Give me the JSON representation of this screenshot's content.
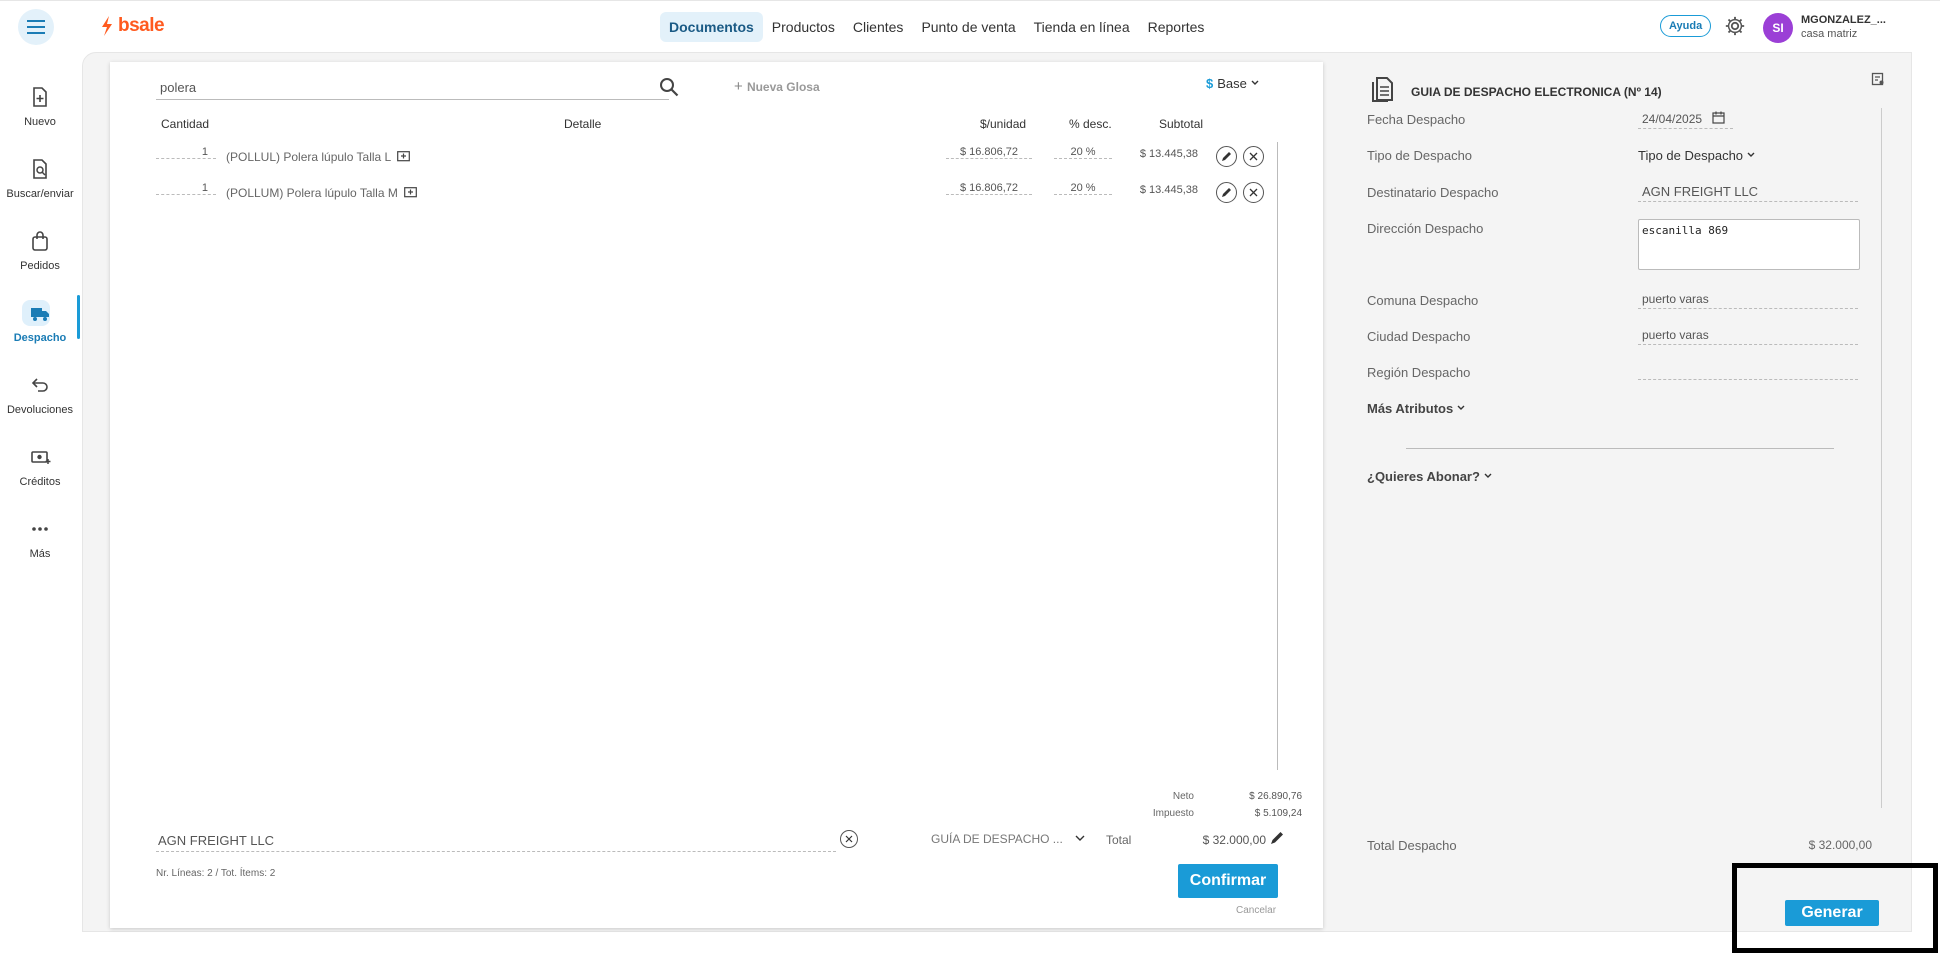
{
  "app": {
    "logo": "bsale"
  },
  "nav": [
    {
      "label": "Documentos",
      "active": true
    },
    {
      "label": "Productos"
    },
    {
      "label": "Clientes"
    },
    {
      "label": "Punto de venta"
    },
    {
      "label": "Tienda en línea"
    },
    {
      "label": "Reportes"
    }
  ],
  "header": {
    "help": "Ayuda",
    "avatar_initials": "SI",
    "user": "MGONZALEZ_...",
    "branch": "casa matriz"
  },
  "sidebar": [
    {
      "label": "Nuevo",
      "icon": "file-plus-icon"
    },
    {
      "label": "Buscar/enviar",
      "icon": "file-search-icon"
    },
    {
      "label": "Pedidos",
      "icon": "bag-icon"
    },
    {
      "label": "Despacho",
      "icon": "truck-icon",
      "active": true
    },
    {
      "label": "Devoluciones",
      "icon": "return-icon"
    },
    {
      "label": "Créditos",
      "icon": "money-icon"
    },
    {
      "label": "Más",
      "icon": "more-icon"
    }
  ],
  "document": {
    "search_value": "polera",
    "new_glosa": "Nueva Glosa",
    "price_list": "Base",
    "columns": {
      "qty": "Cantidad",
      "detail": "Detalle",
      "unit_price": "$/unidad",
      "discount": "% desc.",
      "subtotal": "Subtotal"
    },
    "items": [
      {
        "qty": "1",
        "detail": "(POLLUL) Polera lúpulo Talla L",
        "unit_price": "$ 16.806,72",
        "discount": "20 %",
        "subtotal": "$ 13.445,38"
      },
      {
        "qty": "1",
        "detail": "(POLLUM) Polera lúpulo Talla M",
        "unit_price": "$ 16.806,72",
        "discount": "20 %",
        "subtotal": "$ 13.445,38"
      }
    ],
    "totals": {
      "neto_label": "Neto",
      "neto": "$ 26.890,76",
      "impuesto_label": "Impuesto",
      "impuesto": "$ 5.109,24",
      "total_label": "Total",
      "total": "$ 32.000,00"
    },
    "client": "AGN FREIGHT LLC",
    "doc_type": "GUÍA DE DESPACHO ...",
    "counts": "Nr. Líneas: 2 / Tot. Ítems: 2",
    "confirm": "Confirmar",
    "cancel": "Cancelar"
  },
  "dispatch": {
    "title": "GUIA DE DESPACHO ELECTRONICA (Nº 14)",
    "fecha_label": "Fecha Despacho",
    "fecha": "24/04/2025",
    "tipo_label": "Tipo de Despacho",
    "tipo": "Tipo de Despacho",
    "dest_label": "Destinatario Despacho",
    "dest": "AGN FREIGHT LLC",
    "dir_label": "Dirección Despacho",
    "dir": "escanilla 869",
    "comuna_label": "Comuna Despacho",
    "comuna": "puerto varas",
    "ciudad_label": "Ciudad Despacho",
    "ciudad": "puerto varas",
    "region_label": "Región Despacho",
    "region": "",
    "more_attrs": "Más Atributos",
    "abonar": "¿Quieres Abonar?",
    "total_label": "Total Despacho",
    "total": "$ 32.000,00",
    "generate": "Generar"
  }
}
